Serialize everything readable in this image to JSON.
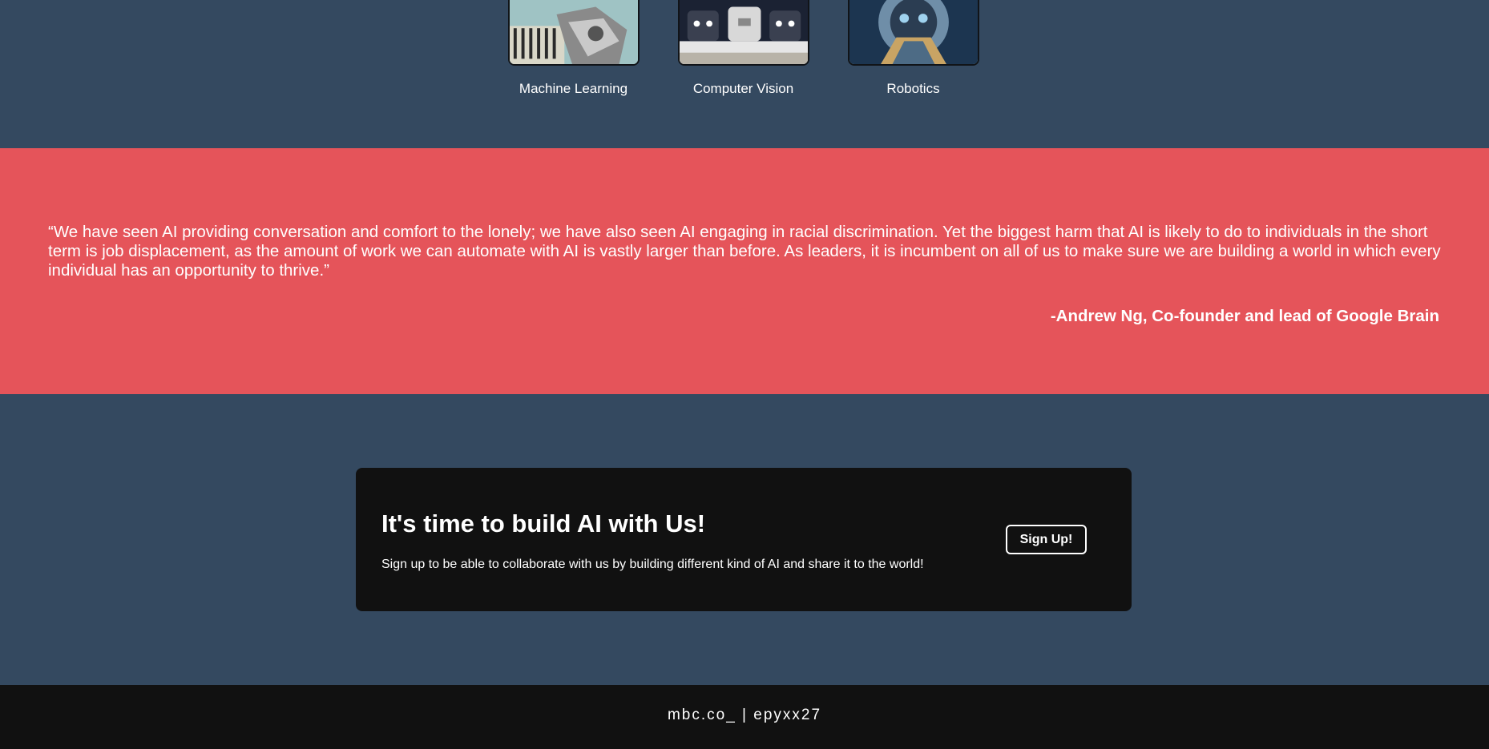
{
  "topics": [
    {
      "label": "Machine Learning",
      "image": "robot-hand-piano-image"
    },
    {
      "label": "Computer Vision",
      "image": "robot-faces-image"
    },
    {
      "label": "Robotics",
      "image": "robot-head-image"
    }
  ],
  "quote": {
    "text": "“We have seen AI providing conversation and comfort to the lonely; we have also seen AI engaging in racial discrimination. Yet the biggest harm that AI is likely to do to individuals in the short term is job displacement, as the amount of work we can automate with AI is vastly larger than before. As leaders, it is incumbent on all of us to make sure we are building a world in which every individual has an opportunity to thrive.”",
    "author": "-Andrew Ng, Co-founder and lead of Google Brain"
  },
  "cta": {
    "title": "It's time to build AI with Us!",
    "subtitle": "Sign up to be able to collaborate with us by building different kind of AI and share it to the world!",
    "button_label": "Sign Up!"
  },
  "footer": {
    "text": "mbc.co_ | epyxx27"
  },
  "colors": {
    "navy": "#344960",
    "coral": "#e5545a",
    "dark": "#111111",
    "white": "#ffffff"
  }
}
